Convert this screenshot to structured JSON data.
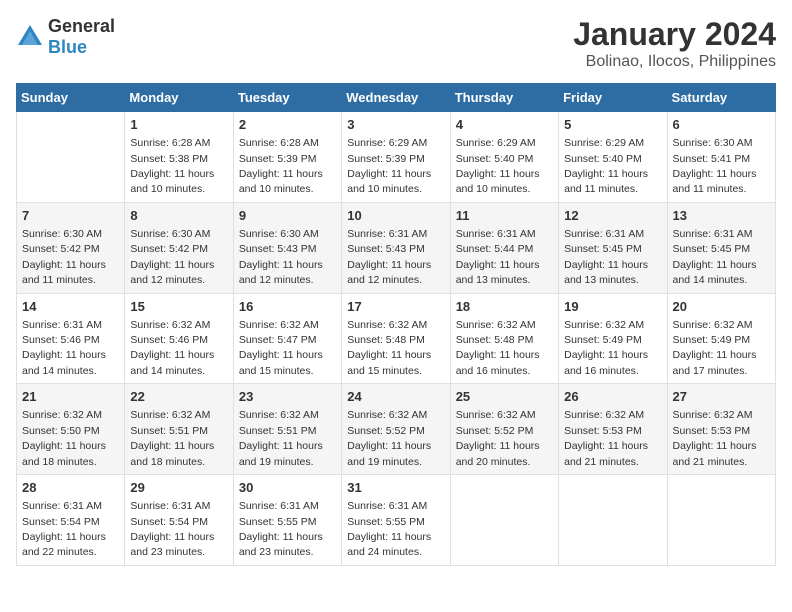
{
  "logo": {
    "general": "General",
    "blue": "Blue"
  },
  "title": "January 2024",
  "subtitle": "Bolinao, Ilocos, Philippines",
  "columns": [
    "Sunday",
    "Monday",
    "Tuesday",
    "Wednesday",
    "Thursday",
    "Friday",
    "Saturday"
  ],
  "weeks": [
    [
      {
        "day": "",
        "info": ""
      },
      {
        "day": "1",
        "info": "Sunrise: 6:28 AM\nSunset: 5:38 PM\nDaylight: 11 hours\nand 10 minutes."
      },
      {
        "day": "2",
        "info": "Sunrise: 6:28 AM\nSunset: 5:39 PM\nDaylight: 11 hours\nand 10 minutes."
      },
      {
        "day": "3",
        "info": "Sunrise: 6:29 AM\nSunset: 5:39 PM\nDaylight: 11 hours\nand 10 minutes."
      },
      {
        "day": "4",
        "info": "Sunrise: 6:29 AM\nSunset: 5:40 PM\nDaylight: 11 hours\nand 10 minutes."
      },
      {
        "day": "5",
        "info": "Sunrise: 6:29 AM\nSunset: 5:40 PM\nDaylight: 11 hours\nand 11 minutes."
      },
      {
        "day": "6",
        "info": "Sunrise: 6:30 AM\nSunset: 5:41 PM\nDaylight: 11 hours\nand 11 minutes."
      }
    ],
    [
      {
        "day": "7",
        "info": "Sunrise: 6:30 AM\nSunset: 5:42 PM\nDaylight: 11 hours\nand 11 minutes."
      },
      {
        "day": "8",
        "info": "Sunrise: 6:30 AM\nSunset: 5:42 PM\nDaylight: 11 hours\nand 12 minutes."
      },
      {
        "day": "9",
        "info": "Sunrise: 6:30 AM\nSunset: 5:43 PM\nDaylight: 11 hours\nand 12 minutes."
      },
      {
        "day": "10",
        "info": "Sunrise: 6:31 AM\nSunset: 5:43 PM\nDaylight: 11 hours\nand 12 minutes."
      },
      {
        "day": "11",
        "info": "Sunrise: 6:31 AM\nSunset: 5:44 PM\nDaylight: 11 hours\nand 13 minutes."
      },
      {
        "day": "12",
        "info": "Sunrise: 6:31 AM\nSunset: 5:45 PM\nDaylight: 11 hours\nand 13 minutes."
      },
      {
        "day": "13",
        "info": "Sunrise: 6:31 AM\nSunset: 5:45 PM\nDaylight: 11 hours\nand 14 minutes."
      }
    ],
    [
      {
        "day": "14",
        "info": "Sunrise: 6:31 AM\nSunset: 5:46 PM\nDaylight: 11 hours\nand 14 minutes."
      },
      {
        "day": "15",
        "info": "Sunrise: 6:32 AM\nSunset: 5:46 PM\nDaylight: 11 hours\nand 14 minutes."
      },
      {
        "day": "16",
        "info": "Sunrise: 6:32 AM\nSunset: 5:47 PM\nDaylight: 11 hours\nand 15 minutes."
      },
      {
        "day": "17",
        "info": "Sunrise: 6:32 AM\nSunset: 5:48 PM\nDaylight: 11 hours\nand 15 minutes."
      },
      {
        "day": "18",
        "info": "Sunrise: 6:32 AM\nSunset: 5:48 PM\nDaylight: 11 hours\nand 16 minutes."
      },
      {
        "day": "19",
        "info": "Sunrise: 6:32 AM\nSunset: 5:49 PM\nDaylight: 11 hours\nand 16 minutes."
      },
      {
        "day": "20",
        "info": "Sunrise: 6:32 AM\nSunset: 5:49 PM\nDaylight: 11 hours\nand 17 minutes."
      }
    ],
    [
      {
        "day": "21",
        "info": "Sunrise: 6:32 AM\nSunset: 5:50 PM\nDaylight: 11 hours\nand 18 minutes."
      },
      {
        "day": "22",
        "info": "Sunrise: 6:32 AM\nSunset: 5:51 PM\nDaylight: 11 hours\nand 18 minutes."
      },
      {
        "day": "23",
        "info": "Sunrise: 6:32 AM\nSunset: 5:51 PM\nDaylight: 11 hours\nand 19 minutes."
      },
      {
        "day": "24",
        "info": "Sunrise: 6:32 AM\nSunset: 5:52 PM\nDaylight: 11 hours\nand 19 minutes."
      },
      {
        "day": "25",
        "info": "Sunrise: 6:32 AM\nSunset: 5:52 PM\nDaylight: 11 hours\nand 20 minutes."
      },
      {
        "day": "26",
        "info": "Sunrise: 6:32 AM\nSunset: 5:53 PM\nDaylight: 11 hours\nand 21 minutes."
      },
      {
        "day": "27",
        "info": "Sunrise: 6:32 AM\nSunset: 5:53 PM\nDaylight: 11 hours\nand 21 minutes."
      }
    ],
    [
      {
        "day": "28",
        "info": "Sunrise: 6:31 AM\nSunset: 5:54 PM\nDaylight: 11 hours\nand 22 minutes."
      },
      {
        "day": "29",
        "info": "Sunrise: 6:31 AM\nSunset: 5:54 PM\nDaylight: 11 hours\nand 23 minutes."
      },
      {
        "day": "30",
        "info": "Sunrise: 6:31 AM\nSunset: 5:55 PM\nDaylight: 11 hours\nand 23 minutes."
      },
      {
        "day": "31",
        "info": "Sunrise: 6:31 AM\nSunset: 5:55 PM\nDaylight: 11 hours\nand 24 minutes."
      },
      {
        "day": "",
        "info": ""
      },
      {
        "day": "",
        "info": ""
      },
      {
        "day": "",
        "info": ""
      }
    ]
  ]
}
